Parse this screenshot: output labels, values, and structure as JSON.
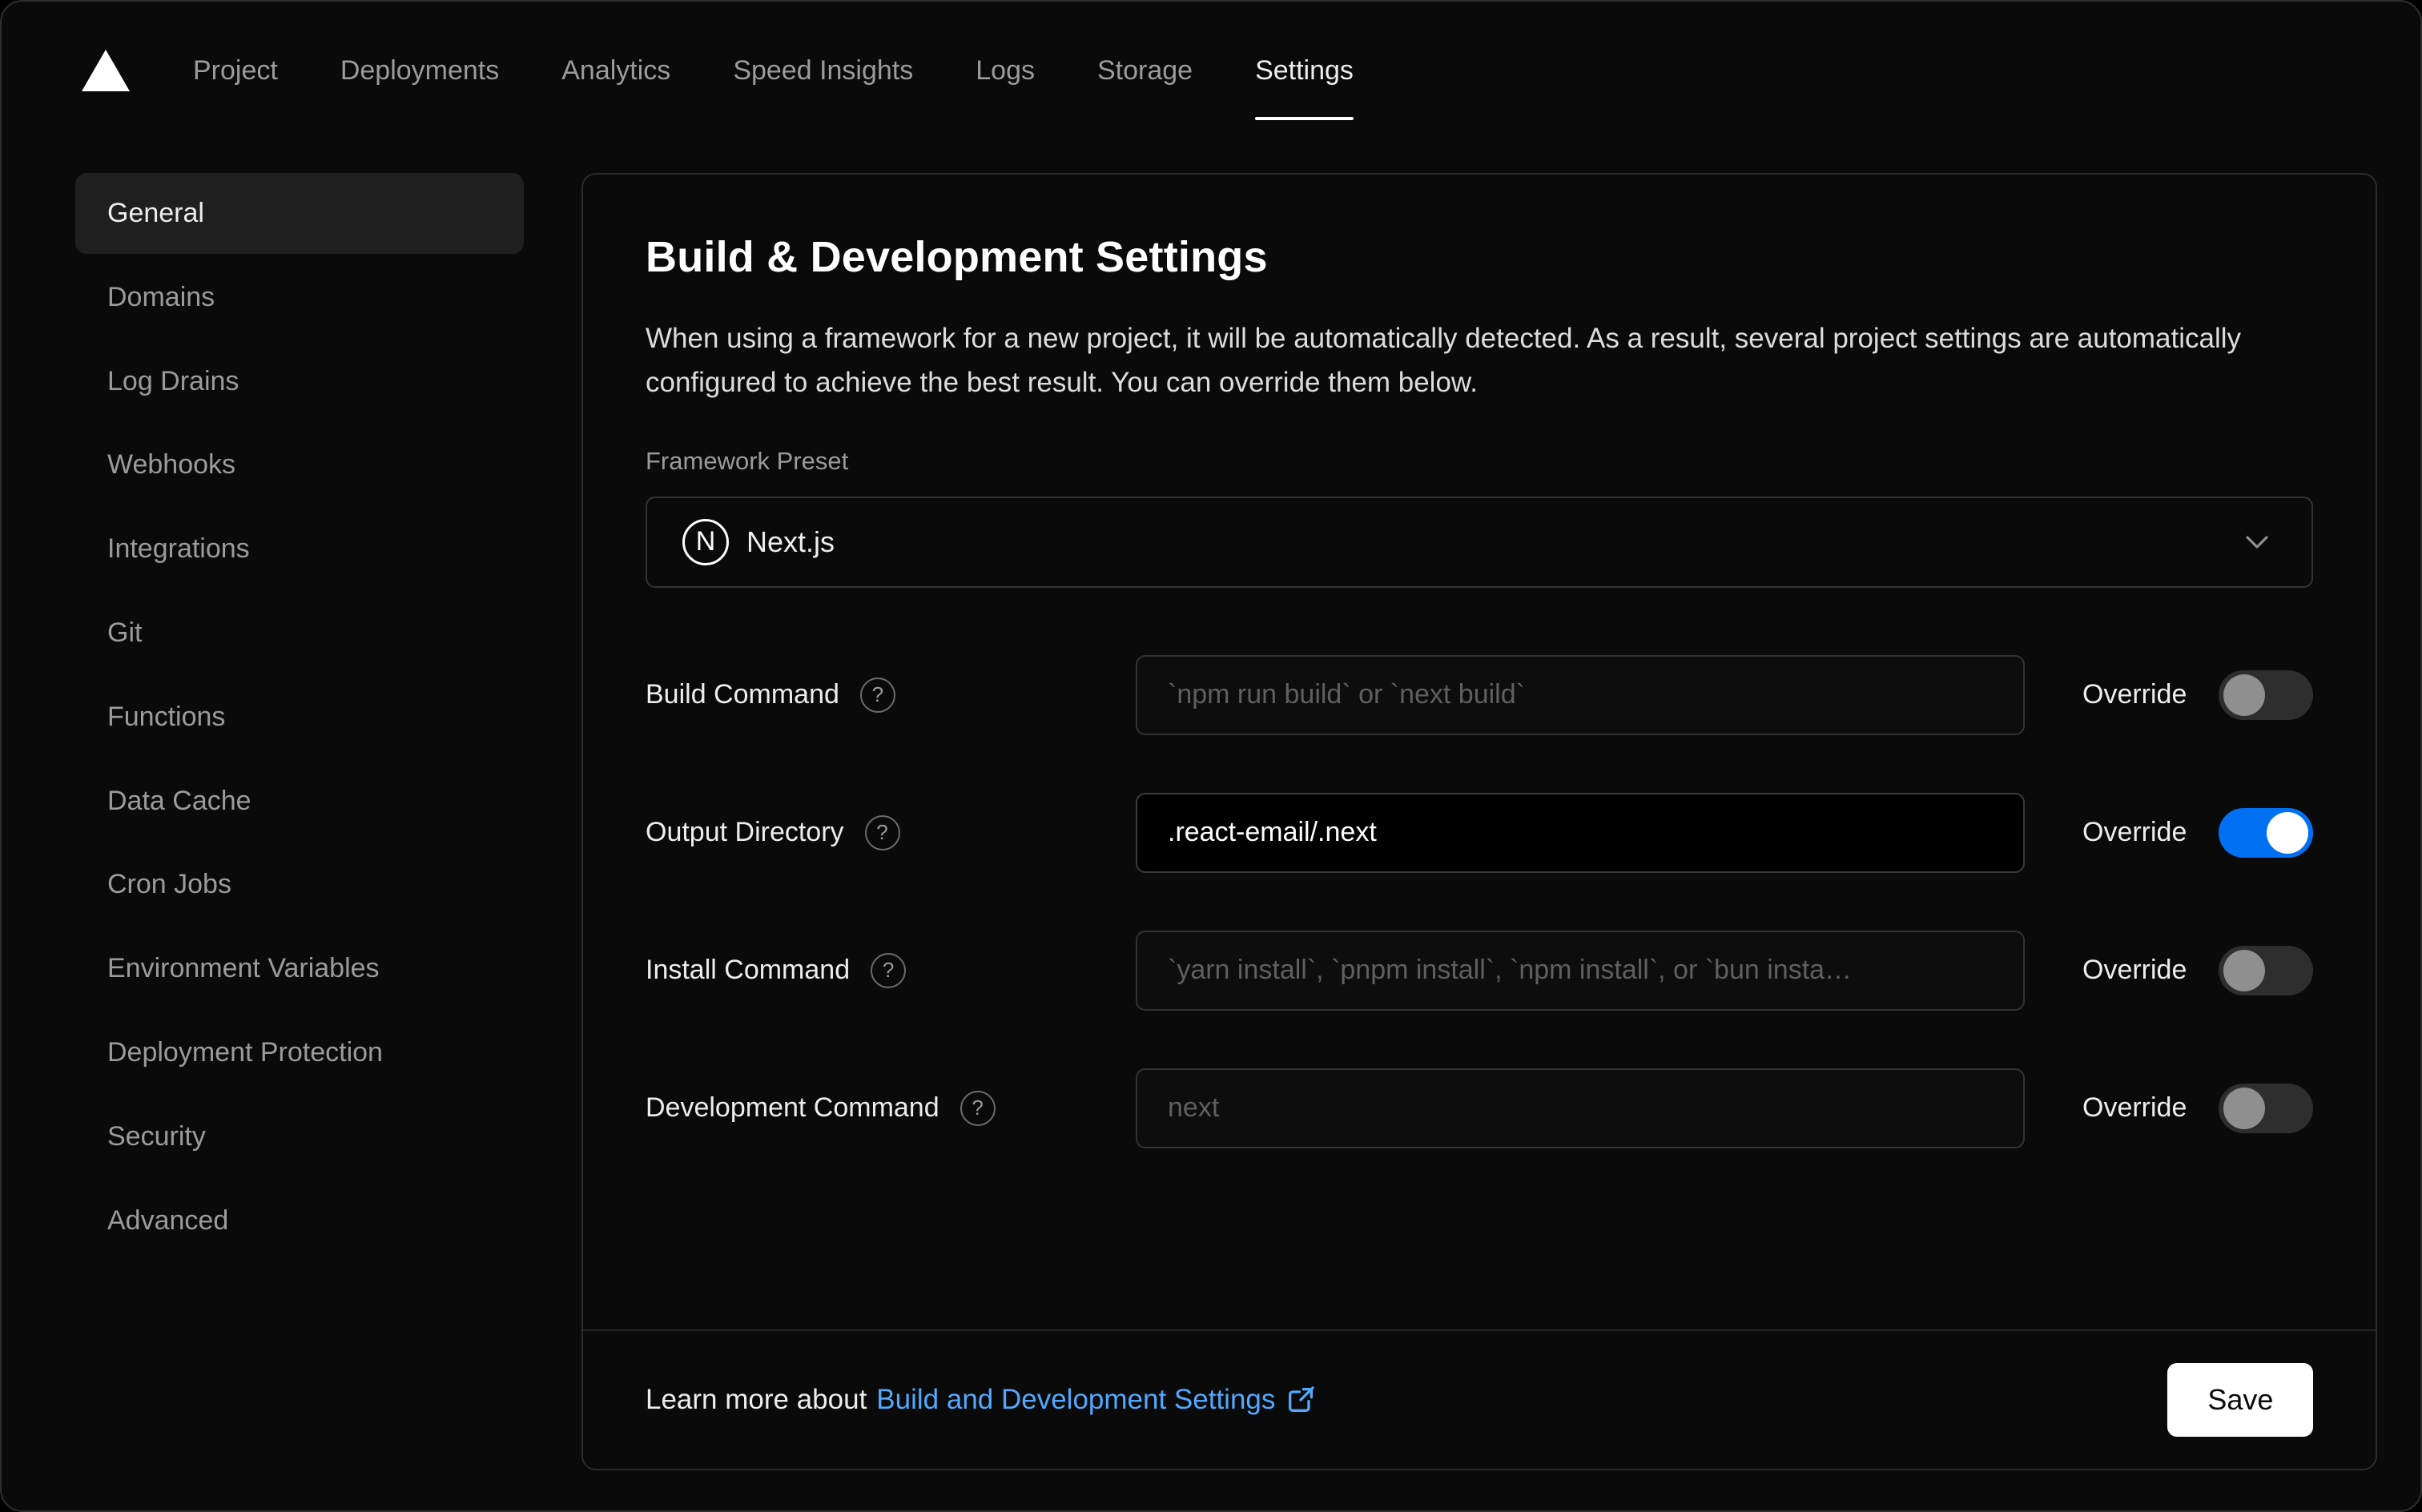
{
  "nav": {
    "logo": "vercel-triangle-logo",
    "items": [
      {
        "label": "Project"
      },
      {
        "label": "Deployments"
      },
      {
        "label": "Analytics"
      },
      {
        "label": "Speed Insights"
      },
      {
        "label": "Logs"
      },
      {
        "label": "Storage"
      },
      {
        "label": "Settings"
      }
    ],
    "active": "Settings"
  },
  "sidebar": {
    "items": [
      {
        "label": "General"
      },
      {
        "label": "Domains"
      },
      {
        "label": "Log Drains"
      },
      {
        "label": "Webhooks"
      },
      {
        "label": "Integrations"
      },
      {
        "label": "Git"
      },
      {
        "label": "Functions"
      },
      {
        "label": "Data Cache"
      },
      {
        "label": "Cron Jobs"
      },
      {
        "label": "Environment Variables"
      },
      {
        "label": "Deployment Protection"
      },
      {
        "label": "Security"
      },
      {
        "label": "Advanced"
      }
    ],
    "active": "General"
  },
  "panel": {
    "title": "Build & Development Settings",
    "description": "When using a framework for a new project, it will be automatically detected. As a result, several project settings are automatically configured to achieve the best result. You can override them below.",
    "framework": {
      "label": "Framework Preset",
      "value": "Next.js",
      "logo": "N"
    },
    "override_label": "Override",
    "fields": [
      {
        "label": "Build Command",
        "placeholder": "`npm run build` or `next build`",
        "value": "",
        "override": false
      },
      {
        "label": "Output Directory",
        "placeholder": "",
        "value": ".react-email/.next",
        "override": true
      },
      {
        "label": "Install Command",
        "placeholder": "`yarn install`, `pnpm install`, `npm install`, or `bun insta…",
        "value": "",
        "override": false
      },
      {
        "label": "Development Command",
        "placeholder": "next",
        "value": "",
        "override": false
      }
    ],
    "footer": {
      "learn_more_prefix": "Learn more about",
      "link_label": "Build and Development Settings",
      "save_label": "Save"
    }
  },
  "colors": {
    "background": "#0a0a0a",
    "card_border": "#2c2c2c",
    "accent_blue": "#0070f3",
    "link_blue": "#52a8ff",
    "active_item_bg": "#1f1f1f",
    "muted_text": "#9b9b9b"
  }
}
